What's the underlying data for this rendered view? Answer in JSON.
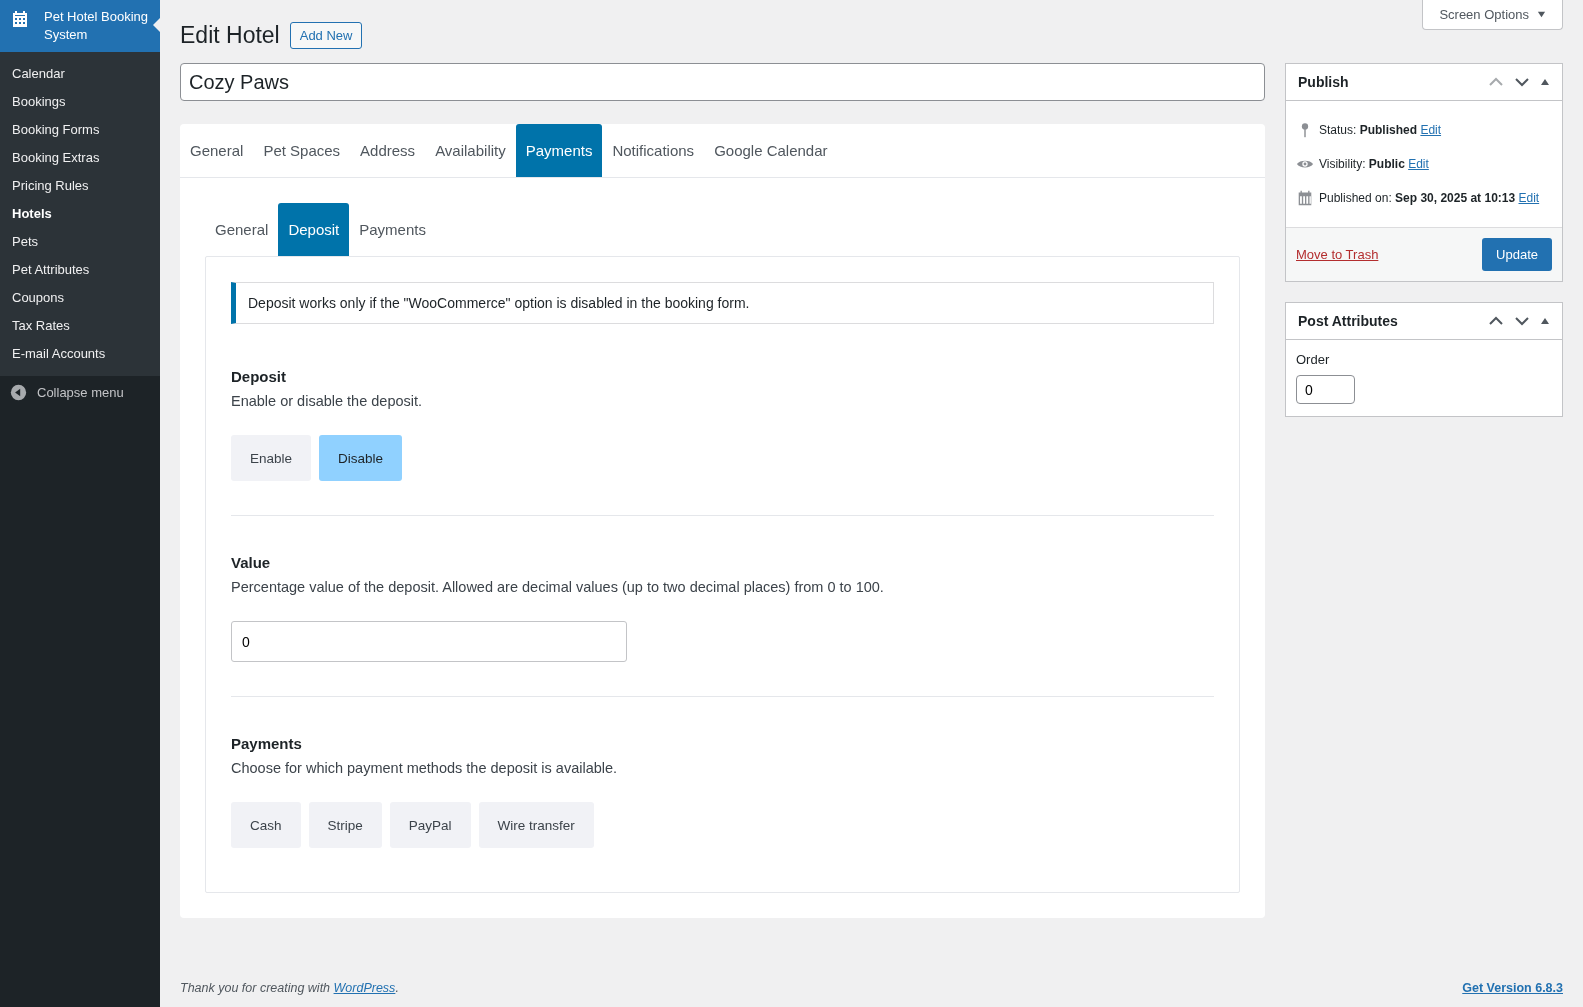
{
  "sidebar": {
    "brand": "Pet Hotel Booking System",
    "items": [
      {
        "label": "Calendar",
        "selected": false
      },
      {
        "label": "Bookings",
        "selected": false
      },
      {
        "label": "Booking Forms",
        "selected": false
      },
      {
        "label": "Booking Extras",
        "selected": false
      },
      {
        "label": "Pricing Rules",
        "selected": false
      },
      {
        "label": "Hotels",
        "selected": true
      },
      {
        "label": "Pets",
        "selected": false
      },
      {
        "label": "Pet Attributes",
        "selected": false
      },
      {
        "label": "Coupons",
        "selected": false
      },
      {
        "label": "Tax Rates",
        "selected": false
      },
      {
        "label": "E-mail Accounts",
        "selected": false
      }
    ],
    "collapse": "Collapse menu"
  },
  "screen_options": "Screen Options",
  "page_title": "Edit Hotel",
  "add_new": "Add New",
  "title_field": {
    "value": "Cozy Paws"
  },
  "tabs": [
    {
      "label": "General",
      "selected": false
    },
    {
      "label": "Pet Spaces",
      "selected": false
    },
    {
      "label": "Address",
      "selected": false
    },
    {
      "label": "Availability",
      "selected": false
    },
    {
      "label": "Payments",
      "selected": true
    },
    {
      "label": "Notifications",
      "selected": false
    },
    {
      "label": "Google Calendar",
      "selected": false
    }
  ],
  "subtabs": [
    {
      "label": "General",
      "selected": false
    },
    {
      "label": "Deposit",
      "selected": true
    },
    {
      "label": "Payments",
      "selected": false
    }
  ],
  "notice": "Deposit works only if the \"WooCommerce\" option is disabled in the booking form.",
  "sections": [
    {
      "kind": "choice",
      "heading": "Deposit",
      "description": "Enable or disable the deposit.",
      "options": [
        {
          "label": "Enable",
          "selected": false
        },
        {
          "label": "Disable",
          "selected": true
        }
      ]
    },
    {
      "kind": "input",
      "heading": "Value",
      "description": "Percentage value of the deposit. Allowed are decimal values (up to two decimal places) from 0 to 100.",
      "value": "0"
    },
    {
      "kind": "choice",
      "heading": "Payments",
      "description": "Choose for which payment methods the deposit is available.",
      "options": [
        {
          "label": "Cash",
          "selected": false
        },
        {
          "label": "Stripe",
          "selected": false
        },
        {
          "label": "PayPal",
          "selected": false
        },
        {
          "label": "Wire transfer",
          "selected": false
        }
      ]
    }
  ],
  "publish": {
    "title": "Publish",
    "rows": [
      {
        "kind": "status",
        "label": "Status:",
        "value": "Published",
        "link": "Edit"
      },
      {
        "kind": "visibility",
        "label": "Visibility:",
        "value": "Public",
        "link": "Edit"
      },
      {
        "kind": "date",
        "label": "Published on:",
        "value": "Sep 30, 2025 at 10:13",
        "link": "Edit"
      }
    ],
    "trash": "Move to Trash",
    "update": "Update"
  },
  "post_attributes": {
    "title": "Post Attributes",
    "order_label": "Order",
    "order_value": "0"
  },
  "footer": {
    "text": "Thank you for creating with ",
    "link": "WordPress",
    "after": ".",
    "version": "Get Version 6.8.3"
  }
}
